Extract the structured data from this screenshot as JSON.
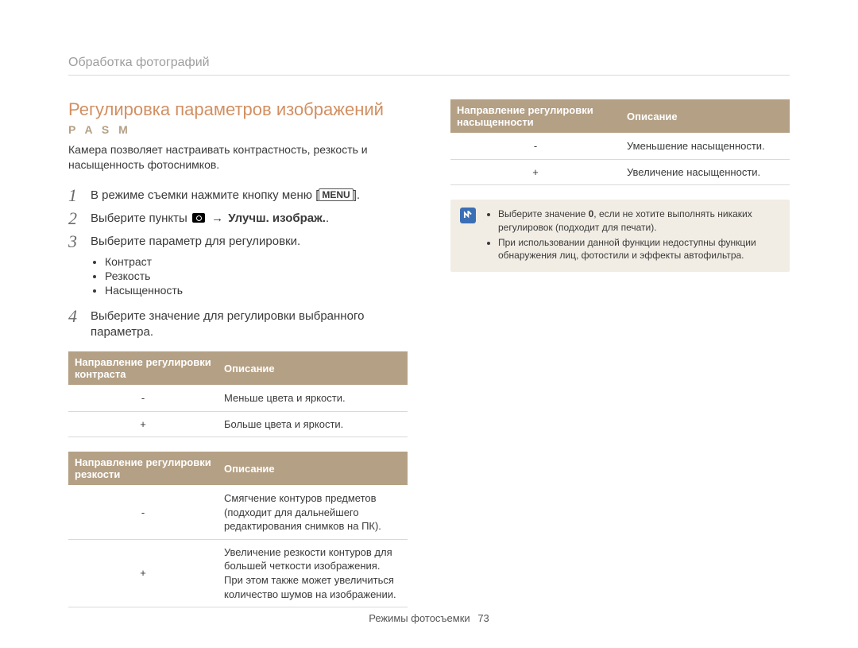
{
  "breadcrumb": "Обработка фотографий",
  "title": "Регулировка параметров изображений",
  "modes": "P A S M",
  "intro": "Камера позволяет настраивать контрастность, резкость и насыщенность фотоснимков.",
  "steps": {
    "s1_a": "В режиме съемки нажмите кнопку меню [",
    "s1_menu": "MENU",
    "s1_b": "].",
    "s2_a": "Выберите пункты ",
    "s2_arrow": "→",
    "s2_b": "Улучш. изображ.",
    "s3": "Выберите параметр для регулировки.",
    "s4": "Выберите значение для регулировки выбранного параметра."
  },
  "bullets": {
    "b1": "Контраст",
    "b2": "Резкость",
    "b3": "Насыщенность"
  },
  "table_contrast": {
    "h1": "Направление регулировки контраста",
    "h2": "Описание",
    "r1c1": "-",
    "r1c2": "Меньше цвета и яркости.",
    "r2c1": "+",
    "r2c2": "Больше цвета и яркости."
  },
  "table_sharp": {
    "h1": "Направление регулировки резкости",
    "h2": "Описание",
    "r1c1": "-",
    "r1c2": "Смягчение контуров предметов (подходит для дальнейшего редактирования снимков на ПК).",
    "r2c1": "+",
    "r2c2": "Увеличение резкости контуров для большей четкости изображения. При этом также может увеличиться количество шумов на изображении."
  },
  "table_sat": {
    "h1": "Направление регулировки насыщенности",
    "h2": "Описание",
    "r1c1": "-",
    "r1c2": "Уменьшение насыщенности.",
    "r2c1": "+",
    "r2c2": "Увеличение насыщенности."
  },
  "notes": {
    "n1_a": "Выберите значение ",
    "n1_bold": "0",
    "n1_b": ", если не хотите выполнять никаких регулировок (подходит для печати).",
    "n2": "При использовании данной функции недоступны функции обнаружения лиц, фотостили и эффекты автофильтра."
  },
  "footer": {
    "section": "Режимы фотосъемки",
    "page": "73"
  }
}
